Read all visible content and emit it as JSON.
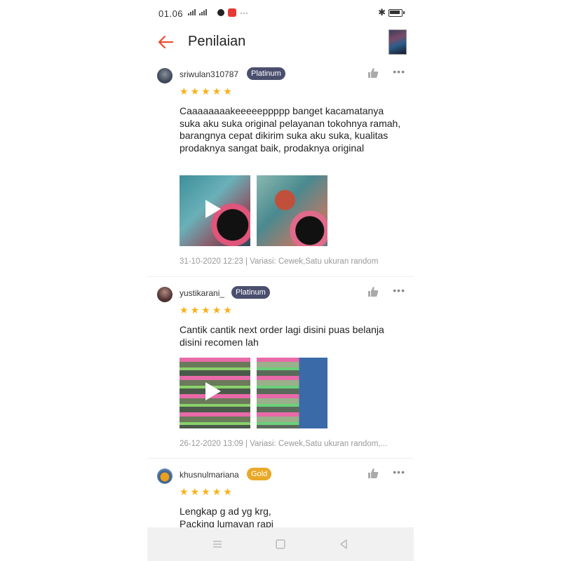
{
  "status_bar": {
    "time": "01.06"
  },
  "header": {
    "title": "Penilaian"
  },
  "reviews": [
    {
      "username": "sriwulan310787",
      "badge": "Platinum",
      "rating": 5,
      "text": "Caaaaaaaakeeeeeppppp banget kacamatanya suka aku suka original pelayanan tokohnya ramah, barangnya cepat dikirim suka aku suka, kualitas prodaknya sangat baik, prodaknya original",
      "meta": "31-10-2020 12:23 | Variasi: Cewek,Satu ukuran random"
    },
    {
      "username": "yustikarani_",
      "badge": "Platinum",
      "rating": 5,
      "text": "Cantik cantik next order lagi disini puas belanja disini recomen lah",
      "meta": "26-12-2020 13:09 | Variasi: Cewek,Satu ukuran random,..."
    },
    {
      "username": "khusnulmariana",
      "badge": "Gold",
      "rating": 5,
      "text_line1": "Lengkap g ad yg krg,",
      "text_line2": "Packing lumayan rapi"
    }
  ],
  "colors": {
    "accent": "#ee4d2d",
    "star": "#f6b21b",
    "badge_platinum": "#4b4f6e",
    "badge_gold": "#e9a827"
  }
}
